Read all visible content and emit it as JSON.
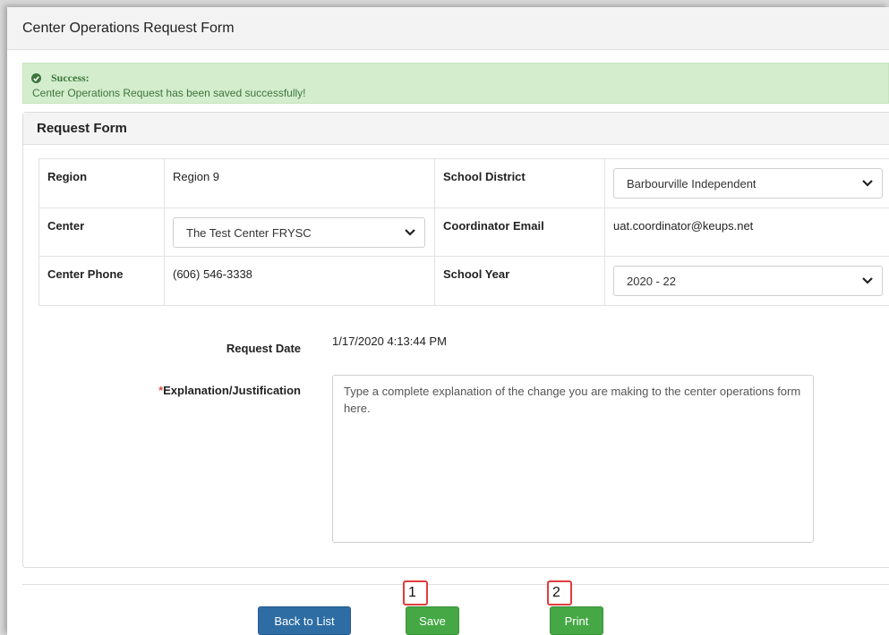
{
  "window": {
    "title": "Center Operations Request Form"
  },
  "alert": {
    "heading": "Success:",
    "message": "Center Operations Request has been saved successfully!",
    "color": "#3c763d"
  },
  "panel": {
    "title": "Request Form"
  },
  "info": {
    "region_label": "Region",
    "region_value": "Region 9",
    "district_label": "School District",
    "district_value": "Barbourville Independent",
    "center_label": "Center",
    "center_value": "The Test Center FRYSC",
    "email_label": "Coordinator Email",
    "email_value": "uat.coordinator@keups.net",
    "phone_label": "Center Phone",
    "phone_value": "(606) 546-3338",
    "year_label": "School Year",
    "year_value": "2020 - 22"
  },
  "form": {
    "request_date_label": "Request Date",
    "request_date_value": "1/17/2020 4:13:44 PM",
    "explanation_label": "Explanation/Justification",
    "required_mark": "*",
    "explanation_text": "Type a complete explanation of the change you are making to the center operations form here."
  },
  "buttons": {
    "back": "Back to List",
    "save": "Save",
    "print": "Print"
  },
  "callouts": {
    "one": "1",
    "two": "2"
  },
  "colors": {
    "primary": "#2e6da4",
    "success": "#45a845",
    "required": "#d9534f",
    "callout": "#e03c3c"
  }
}
